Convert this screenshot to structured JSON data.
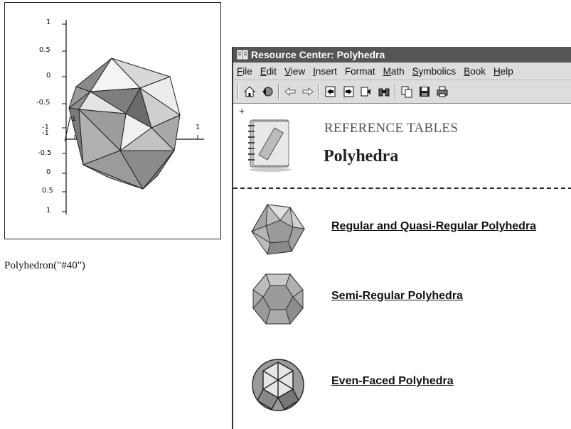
{
  "plot": {
    "z_ticks_top": [
      "1",
      "0.5",
      "0",
      "-0.5",
      "-1"
    ],
    "z_ticks_bottom": [
      "-1",
      "-0.5",
      "0",
      "0.5",
      "1"
    ],
    "x_tick_left": "-1",
    "x_tick_right": "1"
  },
  "caption": "Polyhedron(\"#40\")",
  "window": {
    "title": "Resource Center: Polyhedra",
    "menu": [
      {
        "u": "F",
        "rest": "ile"
      },
      {
        "u": "E",
        "rest": "dit"
      },
      {
        "u": "V",
        "rest": "iew"
      },
      {
        "u": "I",
        "rest": "nsert"
      },
      {
        "u": "",
        "rest": "F",
        "pre": "",
        "full": "Format"
      },
      {
        "u": "M",
        "rest": "ath"
      },
      {
        "u": "S",
        "rest": "ymbolics"
      },
      {
        "u": "B",
        "rest": "ook"
      },
      {
        "u": "H",
        "rest": "elp"
      }
    ],
    "toolbar_icons": [
      "home-icon",
      "back-globe-icon",
      "back-arrow-icon",
      "forward-arrow-icon",
      "prev-page-icon",
      "next-page-icon",
      "index-icon",
      "search-binoculars-icon",
      "copy-icon",
      "save-icon",
      "print-icon"
    ],
    "content": {
      "plus": "+",
      "section_title": "REFERENCE TABLES",
      "page_title": "Polyhedra",
      "links": [
        "Regular and Quasi-Regular Polyhedra",
        "Semi-Regular Polyhedra",
        "Even-Faced Polyhedra"
      ]
    }
  }
}
